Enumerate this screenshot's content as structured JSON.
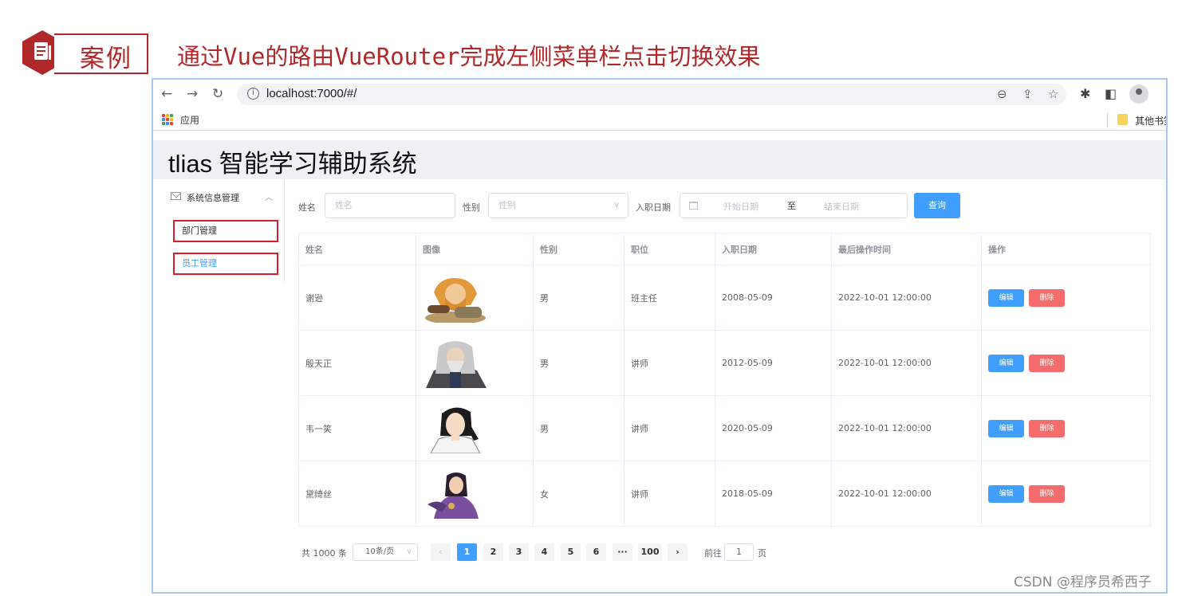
{
  "slide": {
    "case_label": "案例",
    "title": "通过Vue的路由VueRouter完成左侧菜单栏点击切换效果",
    "accent_color": "#b0282a",
    "icon": "document-icon"
  },
  "browser": {
    "back_icon": "arrow-left-icon",
    "forward_icon": "arrow-right-icon",
    "reload_icon": "reload-icon",
    "info_glyph": "i",
    "url": "localhost:7000/#/",
    "bookmarks": {
      "apps_label": "应用",
      "other_label": "其他书签"
    }
  },
  "app": {
    "title": "tlias 智能学习辅助系统",
    "sidebar": {
      "group_label": "系统信息管理",
      "items": [
        {
          "label": "部门管理",
          "active": false
        },
        {
          "label": "员工管理",
          "active": true
        }
      ]
    },
    "search": {
      "name_label": "姓名",
      "name_placeholder": "姓名",
      "gender_label": "性别",
      "gender_placeholder": "性别",
      "date_label": "入职日期",
      "date_start_placeholder": "开始日期",
      "date_separator": "至",
      "date_end_placeholder": "结束日期",
      "query_button": "查询"
    },
    "table": {
      "columns": [
        "姓名",
        "图像",
        "性别",
        "职位",
        "入职日期",
        "最后操作时间",
        "操作"
      ],
      "rows": [
        {
          "name": "谢逊",
          "gender": "男",
          "position": "班主任",
          "entry_date": "2008-05-09",
          "updated": "2022-10-01 12:00:00",
          "avatar": "avatar-xie-xun"
        },
        {
          "name": "殷天正",
          "gender": "男",
          "position": "讲师",
          "entry_date": "2012-05-09",
          "updated": "2022-10-01 12:00:00",
          "avatar": "avatar-yin-tianzheng"
        },
        {
          "name": "韦一笑",
          "gender": "男",
          "position": "讲师",
          "entry_date": "2020-05-09",
          "updated": "2022-10-01 12:00:00",
          "avatar": "avatar-wei-yixiao"
        },
        {
          "name": "黛绮丝",
          "gender": "女",
          "position": "讲师",
          "entry_date": "2018-05-09",
          "updated": "2022-10-01 12:00:00",
          "avatar": "avatar-dai-qisi"
        }
      ],
      "edit_label": "编辑",
      "delete_label": "删除"
    },
    "pagination": {
      "total": "共 1000 条",
      "page_size": "10条/页",
      "pages": [
        "1",
        "2",
        "3",
        "4",
        "5",
        "6",
        "···",
        "100"
      ],
      "current_page": "1",
      "jump_prefix": "前往",
      "jump_value": "1",
      "jump_suffix": "页"
    },
    "colors": {
      "primary": "#409eff",
      "danger": "#f56c6c",
      "header_bg": "#eef1f6"
    }
  },
  "watermark": "CSDN @程序员希西子"
}
